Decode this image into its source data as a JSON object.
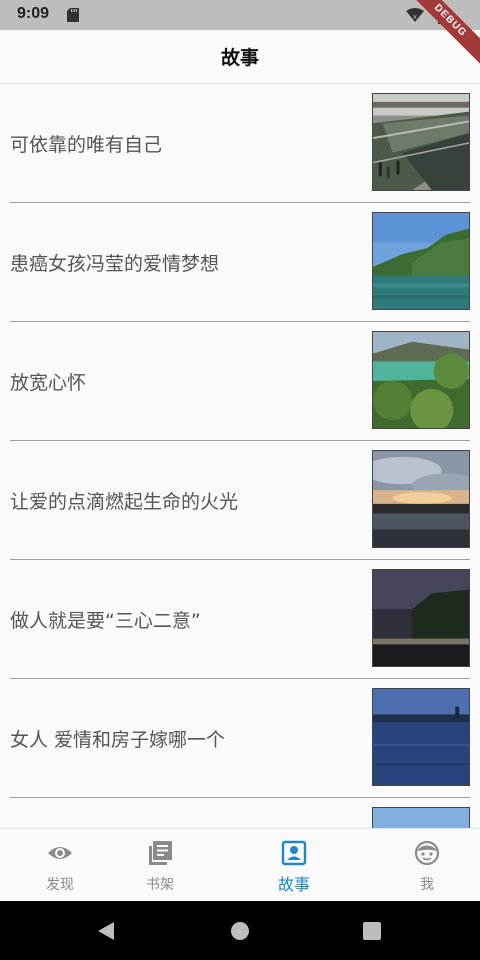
{
  "status_bar": {
    "time": "9:09",
    "icons": [
      "sd-card-icon",
      "wifi-icon",
      "battery-icon"
    ]
  },
  "debug_banner": "DEBUG",
  "header": {
    "title": "故事"
  },
  "stories": [
    {
      "title": "可依靠的唯有自己",
      "thumbnail": "train-station-photo"
    },
    {
      "title": "患癌女孩冯莹的爱情梦想",
      "thumbnail": "lake-mountain-photo"
    },
    {
      "title": "放宽心怀",
      "thumbnail": "green-lake-trees-photo"
    },
    {
      "title": "让爱的点滴燃起生命的火光",
      "thumbnail": "sunset-clouds-photo"
    },
    {
      "title": "做人就是要“三心二意”",
      "thumbnail": "night-bridge-photo"
    },
    {
      "title": "女人 爱情和房子嫁哪一个",
      "thumbnail": "blue-lake-dusk-photo"
    }
  ],
  "bottom_nav": [
    {
      "label": "发现",
      "icon": "eye-icon",
      "active": false
    },
    {
      "label": "书架",
      "icon": "bookshelf-icon",
      "active": false
    },
    {
      "label": "故事",
      "icon": "contact-card-icon",
      "active": true
    },
    {
      "label": "我",
      "icon": "face-icon",
      "active": false
    }
  ],
  "colors": {
    "accent": "#1e88c7",
    "inactive": "#8a8a8a",
    "divider": "#9e9e9e",
    "status_bar": "#bdbdbd",
    "debug_ribbon": "#a23a3a"
  }
}
